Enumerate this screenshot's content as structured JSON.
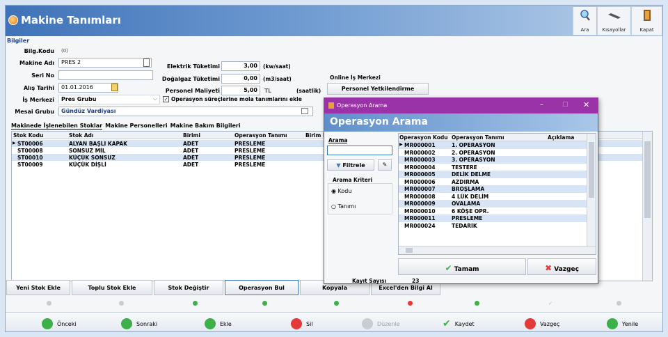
{
  "window": {
    "title": "Makine Tanımları"
  },
  "toolbar": {
    "ara": "Ara",
    "kisayollar": "Kısayollar",
    "kapat": "Kapat"
  },
  "form": {
    "section": "Bilgiler",
    "bilg_kodu_label": "Bilg.Kodu",
    "bilg_kodu_value": "(0)",
    "makine_adi_label": "Makine Adı",
    "makine_adi_value": "PRES 2",
    "seri_no_label": "Seri No",
    "seri_no_value": "",
    "alis_tarihi_label": "Alış Tarihi",
    "alis_tarihi_value": "01.01.2016",
    "is_merkezi_label": "İş Merkezi",
    "is_merkezi_value": "Pres Grubu",
    "mesai_grubu_label": "Mesai Grubu",
    "mesai_grubu_value": "Gündüz Vardiyası",
    "elektrik_label": "Elektrik Tüketimi",
    "elektrik_value": "3,00",
    "elektrik_unit": "(kw/saat)",
    "dogalgaz_label": "Doğalgaz Tüketimi",
    "dogalgaz_value": "0,00",
    "dogalgaz_unit": "(m3/saat)",
    "personel_label": "Personel Maliyeti",
    "personel_value": "5,00",
    "personel_currency": "TL",
    "personel_unit": "(saatlik)",
    "operasyon_checkbox": "Operasyon süreçlerine mola tanımlarını ekle",
    "online_title": "Online İş Merkezi",
    "personel_yetki_button": "Personel Yetkilendirme"
  },
  "tabs": [
    "Makinede İşlenebilen Stoklar",
    "Makine Personelleri",
    "Makine Bakım Bilgileri"
  ],
  "grid": {
    "columns": [
      "Stok Kodu",
      "Stok Adı",
      "Birimi",
      "Operasyon Tanımı",
      "Birim İş"
    ],
    "rows": [
      [
        "ST00006",
        "ALYAN BAŞLI KAPAK",
        "ADET",
        "PRESLEME"
      ],
      [
        "ST00008",
        "SONSUZ MİL",
        "ADET",
        "PRESLEME"
      ],
      [
        "ST00010",
        "KÜÇÜK SONSUZ",
        "ADET",
        "PRESLEME"
      ],
      [
        "ST00009",
        "KÜÇÜK DİŞLİ",
        "ADET",
        "PRESLEME"
      ]
    ]
  },
  "actions": [
    "Yeni Stok Ekle",
    "Toplu Stok Ekle",
    "Stok Değiştir",
    "Operasyon Bul",
    "Kopyala",
    "Excel'den Bilgi Al"
  ],
  "nav": {
    "onceki": "Önceki",
    "sonraki": "Sonraki",
    "ekle": "Ekle",
    "sil": "Sil",
    "duzenle": "Düzenle",
    "kaydet": "Kaydet",
    "vazgec": "Vazgeç",
    "yenile": "Yenile"
  },
  "dialog": {
    "title": "Operasyon Arama",
    "header": "Operasyon Arama",
    "arama_label": "Arama",
    "arama_value": "",
    "filtrele": "Filtrele",
    "kriter_title": "Arama Kriteri",
    "kodu": "Kodu",
    "tanimi": "Tanımı",
    "columns": [
      "Operasyon Kodu",
      "Operasyon Tanımı",
      "Açıklama"
    ],
    "rows": [
      [
        "MR000001",
        "1. OPERASYON"
      ],
      [
        "MR000002",
        "2. OPERASYON"
      ],
      [
        "MR000003",
        "3. OPERASYON"
      ],
      [
        "MR000004",
        "TESTERE"
      ],
      [
        "MR000005",
        "DELİK DELME"
      ],
      [
        "MR000006",
        "AZDIRMA"
      ],
      [
        "MR000007",
        "BROŞLAMA"
      ],
      [
        "MR000008",
        "4 LÜK DELİM"
      ],
      [
        "MR000009",
        "OVALAMA"
      ],
      [
        "MR000010",
        "6 KÖŞE OPR."
      ],
      [
        "MR000011",
        "PRESLEME"
      ],
      [
        "MR000024",
        "TEDARİK"
      ]
    ],
    "tamam": "Tamam",
    "vazgec": "Vazgeç",
    "kayit_label": "Kayıt Sayısı",
    "kayit_value": "23"
  },
  "colors": {
    "accent": "#3f72b8",
    "dialog_title": "#9b33a8",
    "selected_row": "#d6e4f5"
  }
}
